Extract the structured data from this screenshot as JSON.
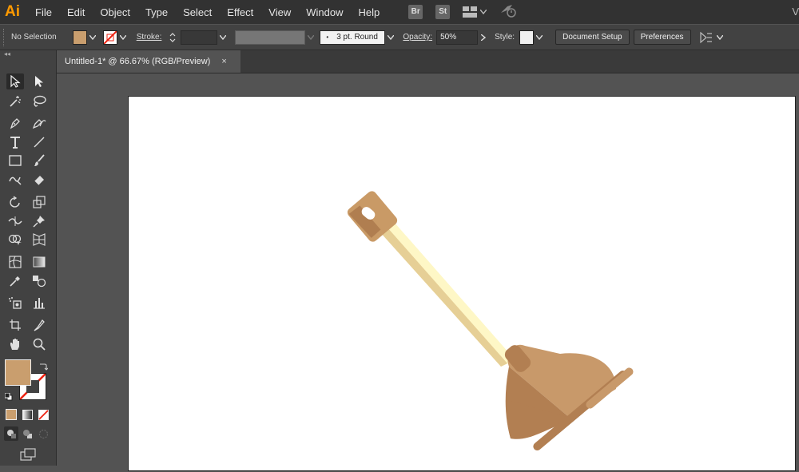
{
  "app": {
    "logo": "Ai"
  },
  "menubar": {
    "items": [
      "File",
      "Edit",
      "Object",
      "Type",
      "Select",
      "Effect",
      "View",
      "Window",
      "Help"
    ],
    "badges": [
      "Br",
      "St"
    ],
    "right_text": "V"
  },
  "control": {
    "selection_label": "No Selection",
    "fill_color": "#c99e6e",
    "stroke_label": "Stroke:",
    "brush_label": "3 pt. Round",
    "opacity_label": "Opacity:",
    "opacity_value": "50%",
    "style_label": "Style:",
    "document_setup": "Document Setup",
    "preferences": "Preferences"
  },
  "document": {
    "tab_title": "Untitled-1* @ 66.67% (RGB/Preview)",
    "close_glyph": "×"
  },
  "tools": {
    "fill_color": "#c99e6e",
    "collapse_glyph": "◂◂"
  },
  "artwork": {
    "name": "plunger",
    "colors": {
      "handle_light": "#fef7c6",
      "handle_shade": "#e6cf96",
      "cap_light": "#c99a66",
      "cap_dark": "#b07e50",
      "cup_light": "#c8996a",
      "cup_dark": "#b27f52"
    }
  }
}
